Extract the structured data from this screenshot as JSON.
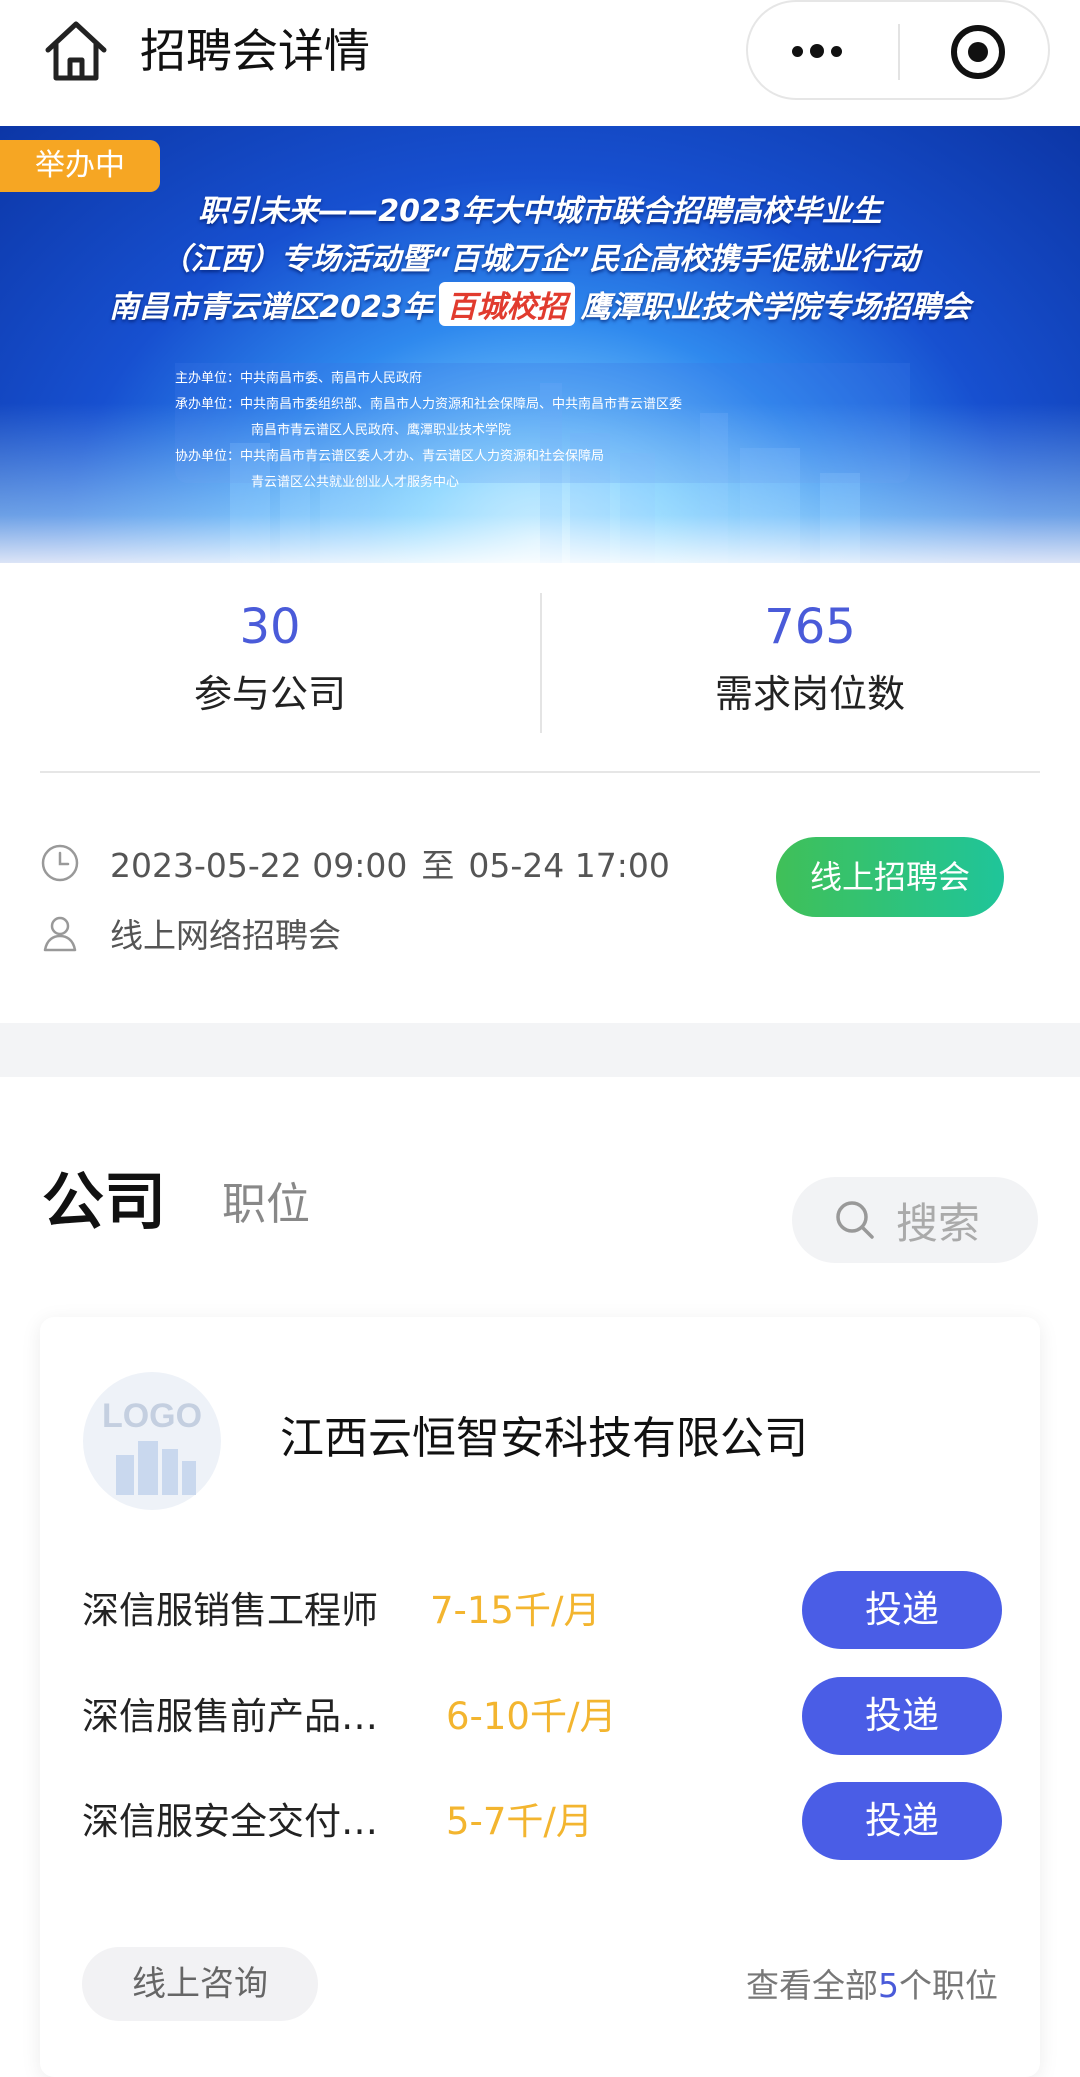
{
  "nav": {
    "title": "招聘会详情"
  },
  "banner": {
    "status_tag": "举办中",
    "line1": "职引未来——2023年大中城市联合招聘高校毕业生",
    "line2": "（江西）专场活动暨“百城万企”民企高校携手促就业行动",
    "line3_a": "南昌市青云谱区2023年",
    "line3_hl": "百城校招",
    "line3_b": "鹰潭职业技术学院专场招聘会",
    "org_host": "主办单位：中共南昌市委、南昌市人民政府",
    "org_undertake_1": "承办单位：中共南昌市委组织部、南昌市人力资源和社会保障局、中共南昌市青云谱区委",
    "org_undertake_2": "南昌市青云谱区人民政府、鹰潭职业技术学院",
    "org_assist_1": "协办单位：中共南昌市青云谱区委人才办、青云谱区人力资源和社会保障局",
    "org_assist_2": "青云谱区公共就业创业人才服务中心"
  },
  "stats": {
    "companies_value": "30",
    "companies_label": "参与公司",
    "positions_value": "765",
    "positions_label": "需求岗位数"
  },
  "meta": {
    "start": "2023-05-22 09:00",
    "to": "至",
    "end": "05-24 17:00",
    "location": "线上网络招聘会",
    "type_button": "线上招聘会"
  },
  "tabs": {
    "company": "公司",
    "position": "职位",
    "search_placeholder": "搜索"
  },
  "company_card": {
    "logo_text": "LOGO",
    "name": "江西云恒智安科技有限公司",
    "jobs": [
      {
        "title": "深信服销售工程师",
        "salary": "7-15千/月",
        "apply": "投递"
      },
      {
        "title": "深信服售前产品…",
        "salary": "6-10千/月",
        "apply": "投递"
      },
      {
        "title": "深信服安全交付…",
        "salary": "5-7千/月",
        "apply": "投递"
      }
    ],
    "consult_button": "线上咨询",
    "view_all_prefix": "查看全部",
    "view_all_count": "5",
    "view_all_suffix": "个职位"
  },
  "colors": {
    "accent": "#4a5bd9",
    "salary": "#f3b52f",
    "status_tag": "#f6a623",
    "green": "#40c058"
  }
}
